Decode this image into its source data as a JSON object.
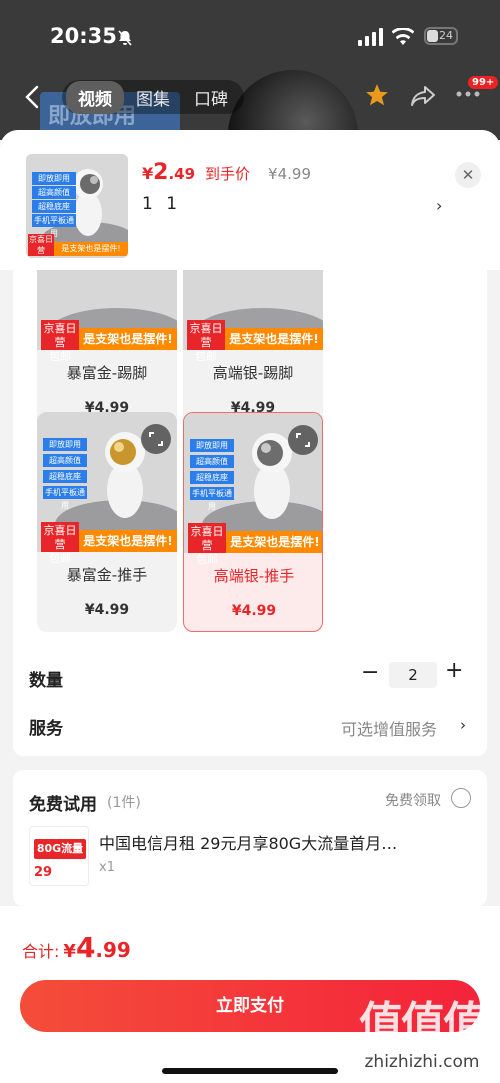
{
  "status_bar": {
    "time": "20:35",
    "battery": "24"
  },
  "nav": {
    "tabs": [
      {
        "label": "视频",
        "active": true
      },
      {
        "label": "图集",
        "active": false
      },
      {
        "label": "口碑",
        "active": false
      }
    ],
    "badge": "99+"
  },
  "background": {
    "promo_text": "即放即用"
  },
  "header": {
    "price_currency": "¥",
    "price_int": "2",
    "price_dec": ".49",
    "price_tag": "到手价",
    "price_original": "¥4.99",
    "spec_text": "1 1"
  },
  "product_tags": {
    "left": "京喜日常包邮",
    "left_line1": "京喜日营",
    "left_line2": "包邮",
    "right": "是支架也是摆件!",
    "blue1": "即放即用",
    "blue2": "超高颜值",
    "blue3": "超稳底座",
    "blue4": "手机平板通用"
  },
  "variants": [
    {
      "name": "暴富金-踢脚",
      "price": "¥4.99",
      "selected": false,
      "tone": "gold"
    },
    {
      "name": "高端银-踢脚",
      "price": "¥4.99",
      "selected": false,
      "tone": "silver"
    },
    {
      "name": "暴富金-推手",
      "price": "¥4.99",
      "selected": false,
      "tone": "gold"
    },
    {
      "name": "高端银-推手",
      "price": "¥4.99",
      "selected": true,
      "tone": "silver"
    }
  ],
  "quantity": {
    "label": "数量",
    "value": "2"
  },
  "service": {
    "label": "服务",
    "value": "可选增值服务"
  },
  "trial": {
    "title": "免费试用",
    "count": "(1件)",
    "claim": "免费领取",
    "item_name": "中国电信月租 29元月享80G大流量首月…",
    "item_qty": "x1",
    "img_text": "80G流量",
    "img_price": "29"
  },
  "footer": {
    "total_label": "合计:",
    "total_currency": "¥",
    "total_int": "4",
    "total_dec": ".99",
    "pay_label": "立即支付"
  },
  "watermark": {
    "logo": "值值值",
    "url": "zhizhizhi.com"
  },
  "colors": {
    "accent": "#e8262a",
    "orange_tag": "#ff8a00",
    "blue_tag": "#2b7de9"
  }
}
